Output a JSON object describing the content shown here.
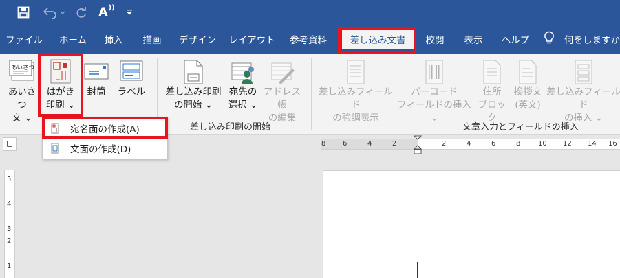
{
  "quick_access": {
    "save_icon": "save-icon",
    "undo_icon": "undo-icon",
    "redo_icon": "redo-icon",
    "font_size_label": "A",
    "customize_icon": "customize-qat-icon"
  },
  "tabs": [
    {
      "label": "ファイル"
    },
    {
      "label": "ホーム"
    },
    {
      "label": "挿入"
    },
    {
      "label": "描画"
    },
    {
      "label": "デザイン"
    },
    {
      "label": "レイアウト"
    },
    {
      "label": "参考資料"
    },
    {
      "label": "差し込み文書",
      "active": true
    },
    {
      "label": "校閲"
    },
    {
      "label": "表示"
    },
    {
      "label": "ヘルプ"
    }
  ],
  "tell_me": {
    "label": "何をしますか"
  },
  "ribbon": {
    "create": {
      "greeting": {
        "line1": "あいさつ",
        "line2": "文 ⌄",
        "icon_text": "あいさつ"
      },
      "hagaki": {
        "line1": "はがき",
        "line2": "印刷 ⌄"
      },
      "envelope": {
        "label": "封筒"
      },
      "labels": {
        "label": "ラベル"
      }
    },
    "start_merge": {
      "start": {
        "line1": "差し込み印刷",
        "line2": "の開始 ⌄"
      },
      "recipients": {
        "line1": "宛先の",
        "line2": "選択 ⌄"
      },
      "edit_list": {
        "line1": "アドレス帳",
        "line2": "の編集"
      },
      "group_label": "差し込み印刷の開始"
    },
    "write_insert": {
      "highlight": {
        "line1": "差し込みフィールド",
        "line2": "の強調表示"
      },
      "barcode": {
        "line1": "バーコード",
        "line2": "フィールドの挿入 ⌄"
      },
      "address_block": {
        "line1": "住所",
        "line2": "ブロック"
      },
      "greeting_line": {
        "line1": "挨拶文",
        "line2": "(英文)"
      },
      "insert_field": {
        "line1": "差し込みフィールド",
        "line2": "の挿入 ⌄"
      },
      "group_label": "文章入力とフィールドの挿入"
    }
  },
  "dropdown": {
    "items": [
      {
        "label": "宛名面の作成(A)"
      },
      {
        "label": "文面の作成(D)"
      }
    ]
  },
  "ruler": {
    "h_labels": [
      "8",
      "6",
      "4",
      "2",
      "2",
      "4",
      "6",
      "8",
      "10",
      "12",
      "14",
      "16"
    ],
    "v_labels": [
      "5",
      "4",
      "3",
      "2",
      "1"
    ]
  },
  "colors": {
    "accent": "#2b579a",
    "highlight_box": "#e8141e",
    "ribbon_bg": "#f3f3f3"
  }
}
